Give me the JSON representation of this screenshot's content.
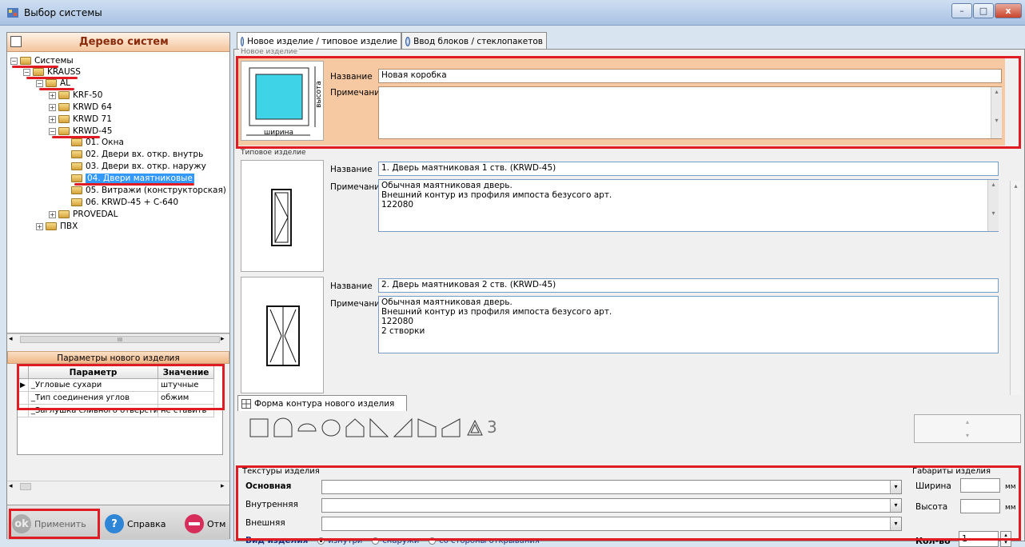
{
  "window": {
    "title": "Выбор системы",
    "minimize": "–",
    "maximize": "□",
    "close": "x"
  },
  "tree": {
    "header": "Дерево систем",
    "nodes": [
      {
        "label": "Системы",
        "toggle": "−"
      },
      {
        "label": "KRAUSS",
        "toggle": "−"
      },
      {
        "label": "AL",
        "toggle": "−"
      },
      {
        "label": "KRF-50",
        "toggle": "+"
      },
      {
        "label": "KRWD 64",
        "toggle": "+"
      },
      {
        "label": "KRWD 71",
        "toggle": "+"
      },
      {
        "label": "KRWD-45",
        "toggle": "−"
      },
      {
        "label": "01. Окна",
        "toggle": ""
      },
      {
        "label": "02. Двери вх. откр. внутрь",
        "toggle": ""
      },
      {
        "label": "03. Двери вх. откр. наружу",
        "toggle": ""
      },
      {
        "label": "04. Двери маятниковые",
        "toggle": ""
      },
      {
        "label": "05. Витражи (конструкторская)",
        "toggle": ""
      },
      {
        "label": "06. KRWD-45 + С-640",
        "toggle": ""
      },
      {
        "label": "PROVEDAL",
        "toggle": "+"
      },
      {
        "label": "ПВХ",
        "toggle": "+"
      }
    ],
    "hscroll_thumb": "III"
  },
  "params": {
    "header": "Параметры нового изделия",
    "col_param": "Параметр",
    "col_value": "Значение",
    "rows": [
      {
        "param": "_Угловые сухари",
        "value": "штучные"
      },
      {
        "param": "_Тип соединения углов",
        "value": "обжим"
      },
      {
        "param": "_Заглушка сливного отверстия",
        "value": "не ставить"
      }
    ]
  },
  "buttons": {
    "apply": "Применить",
    "help": "Справка",
    "cancel": "Отм",
    "ok_icon": "ok",
    "help_icon": "?"
  },
  "tabs": [
    {
      "label": "Новое изделие / типовое изделие"
    },
    {
      "label": "Ввод блоков / стеклопакетов"
    }
  ],
  "new_item": {
    "group_label": "Новое изделие",
    "name_label": "Название",
    "name_value": "Новая коробка",
    "note_label": "Примечание",
    "note_value": "",
    "width_caption": "ширина",
    "height_caption": "высота"
  },
  "typical": {
    "group_label": "Типовое изделие",
    "items": [
      {
        "name_label": "Название",
        "name": "1. Дверь маятниковая 1 ств. (KRWD-45)",
        "note_label": "Примечание",
        "note": "Обычная маятниковая дверь.\nВнешний контур из профиля импоста безусого арт.\n122080"
      },
      {
        "name_label": "Название",
        "name": "2. Дверь маятниковая 2 ств. (KRWD-45)",
        "note_label": "Примечание",
        "note": "Обычная маятниковая дверь.\nВнешний контур из профиля импоста безусого арт.\n122080\n2 створки"
      }
    ]
  },
  "contour": {
    "tab_label": "Форма контура нового изделия",
    "extra_glyph": "3"
  },
  "textures": {
    "group_label": "Текстуры изделия",
    "main_label": "Основная",
    "inner_label": "Внутренняя",
    "outer_label": "Внешняя",
    "view_label": "Вид изделия",
    "view_options": [
      "изнутри",
      "снаружи",
      "со стороны открывания"
    ],
    "view_selected": "изнутри"
  },
  "dimensions": {
    "group_label": "Габариты изделия",
    "width_label": "Ширина",
    "height_label": "Высота",
    "unit": "мм",
    "qty_label": "Кол-во",
    "qty_value": "1"
  },
  "colors": {
    "red_highlight": "#e01b24",
    "glass": "#3fd3e8",
    "selected": "#3399ff",
    "orange_header": "#f3c49c"
  }
}
